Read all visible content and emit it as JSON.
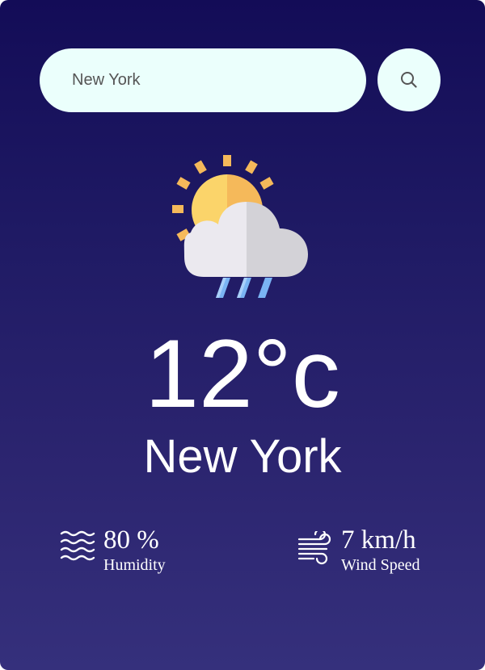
{
  "search": {
    "value": "New York",
    "icon": "search-icon"
  },
  "weather": {
    "icon": "sun-cloud-rain-icon",
    "temperature": "12°c",
    "city": "New York"
  },
  "humidity": {
    "icon": "humidity-waves-icon",
    "value": "80 %",
    "label": "Humidity"
  },
  "wind": {
    "icon": "wind-icon",
    "value": "7 km/h",
    "label": "Wind Speed"
  },
  "colors": {
    "background_top": "#130c57",
    "background_bottom": "#35307c",
    "field": "#ebfffc",
    "text": "#ffffff",
    "sun": "#fbd46a",
    "sun_shade": "#f5b95a",
    "cloud": "#ebe9ef",
    "cloud_shade": "#d3d2d7",
    "rain": "#7ab4f4"
  }
}
